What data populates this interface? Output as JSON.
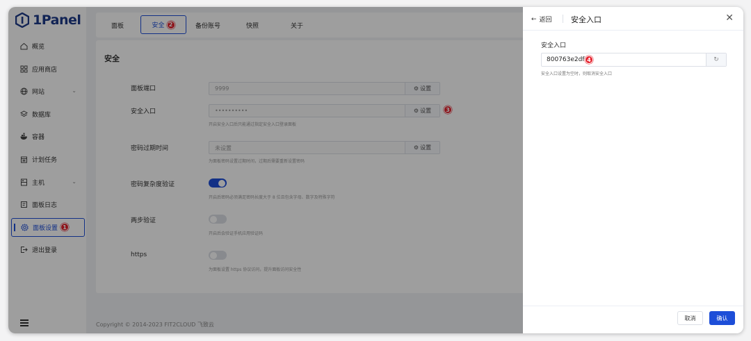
{
  "app": {
    "logo_text": "1Panel"
  },
  "sidebar": {
    "items": [
      {
        "label": "概览",
        "icon": "home-icon",
        "has_chevron": false
      },
      {
        "label": "应用商店",
        "icon": "grid-icon",
        "has_chevron": false
      },
      {
        "label": "网站",
        "icon": "globe-icon",
        "has_chevron": true
      },
      {
        "label": "数据库",
        "icon": "layers-icon",
        "has_chevron": false
      },
      {
        "label": "容器",
        "icon": "docker-icon",
        "has_chevron": false
      },
      {
        "label": "计划任务",
        "icon": "calendar-icon",
        "has_chevron": false
      },
      {
        "label": "主机",
        "icon": "server-icon",
        "has_chevron": true
      },
      {
        "label": "面板日志",
        "icon": "log-icon",
        "has_chevron": false
      },
      {
        "label": "面板设置",
        "icon": "gear-icon",
        "has_chevron": false,
        "active": true,
        "badge": "1"
      },
      {
        "label": "退出登录",
        "icon": "logout-icon",
        "has_chevron": false
      }
    ]
  },
  "tabs": [
    {
      "label": "面板"
    },
    {
      "label": "安全",
      "active": true,
      "badge": "2"
    },
    {
      "label": "备份账号"
    },
    {
      "label": "快照"
    },
    {
      "label": "关于"
    }
  ],
  "security": {
    "title": "安全",
    "panel_port": {
      "label": "面板端口",
      "value": "9999",
      "button": "设置"
    },
    "security_entrance": {
      "label": "安全入口",
      "value": "••••••••••",
      "button": "设置",
      "badge": "3",
      "hint": "开启安全入口后只能通过指定安全入口登录面板"
    },
    "password_expire": {
      "label": "密码过期时间",
      "value": "未设置",
      "button": "设置",
      "hint": "为面板密码设置过期时间，过期后需要重新设置密码"
    },
    "password_complexity": {
      "label": "密码复杂度验证",
      "enabled": true,
      "hint": "开启后密码必须满足密码长度大于 8 位且包含字母、数字及特殊字符"
    },
    "two_step": {
      "label": "两步验证",
      "enabled": false,
      "hint": "开启后会验证手机应用验证码"
    },
    "https": {
      "label": "https",
      "enabled": false,
      "hint": "为面板设置 https 协议访问，提升面板访问安全性"
    }
  },
  "footer": {
    "copyright": "Copyright © 2014-2023 FIT2CLOUD 飞致云"
  },
  "drawer": {
    "back_label": "返回",
    "title": "安全入口",
    "field_label": "安全入口",
    "field_value": "800763e2df",
    "field_badge": "4",
    "hint": "安全入口设置为空时，则取消安全入口",
    "cancel_label": "取消",
    "confirm_label": "确认"
  },
  "colors": {
    "accent": "#1d4ed8",
    "badge": "#e5212d"
  }
}
